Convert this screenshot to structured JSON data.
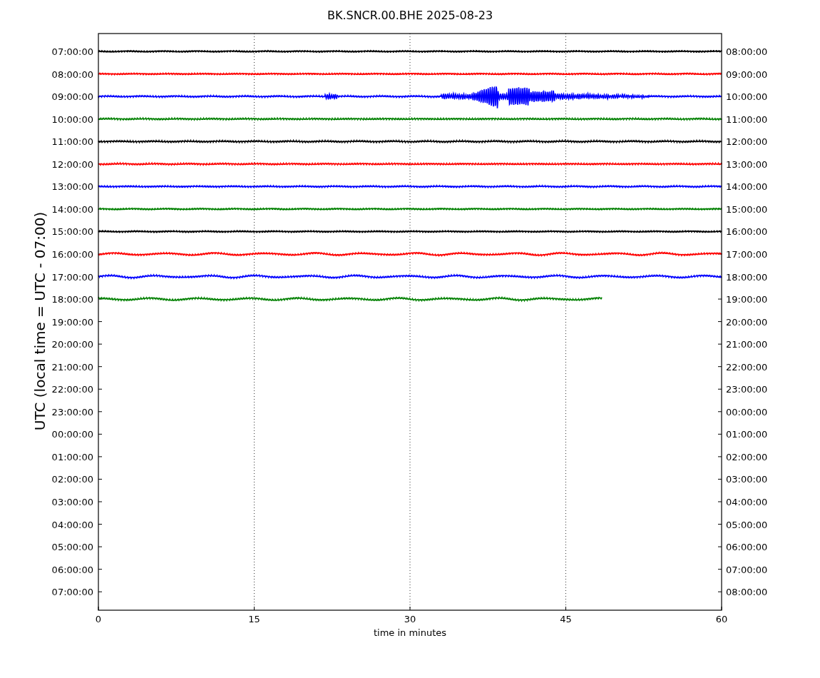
{
  "title": "BK.SNCR.00.BHE 2025-08-23",
  "ylabel": "UTC (local time = UTC - 07:00)",
  "xlabel": "time in minutes",
  "xticks": [
    "0",
    "15",
    "30",
    "45",
    "60"
  ],
  "left_labels": [
    "07:00:00",
    "08:00:00",
    "09:00:00",
    "10:00:00",
    "11:00:00",
    "12:00:00",
    "13:00:00",
    "14:00:00",
    "15:00:00",
    "16:00:00",
    "17:00:00",
    "18:00:00",
    "19:00:00",
    "20:00:00",
    "21:00:00",
    "22:00:00",
    "23:00:00",
    "00:00:00",
    "01:00:00",
    "02:00:00",
    "03:00:00",
    "04:00:00",
    "05:00:00",
    "06:00:00",
    "07:00:00"
  ],
  "right_labels": [
    "08:00:00",
    "09:00:00",
    "10:00:00",
    "11:00:00",
    "12:00:00",
    "13:00:00",
    "14:00:00",
    "15:00:00",
    "16:00:00",
    "17:00:00",
    "18:00:00",
    "19:00:00",
    "20:00:00",
    "21:00:00",
    "22:00:00",
    "23:00:00",
    "00:00:00",
    "01:00:00",
    "02:00:00",
    "03:00:00",
    "04:00:00",
    "05:00:00",
    "06:00:00",
    "07:00:00",
    "08:00:00"
  ],
  "traces": [
    {
      "kind": "quiet",
      "color": "#000000"
    },
    {
      "kind": "quiet",
      "color": "#ff0000"
    },
    {
      "kind": "event",
      "color": "#0000ff"
    },
    {
      "kind": "quiet",
      "color": "#008000"
    },
    {
      "kind": "quiet",
      "color": "#000000"
    },
    {
      "kind": "quiet",
      "color": "#ff0000"
    },
    {
      "kind": "quiet",
      "color": "#0000ff"
    },
    {
      "kind": "quiet",
      "color": "#008000"
    },
    {
      "kind": "quiet",
      "color": "#000000"
    },
    {
      "kind": "wavy",
      "color": "#ff0000"
    },
    {
      "kind": "wavy",
      "color": "#0000ff"
    },
    {
      "kind": "partial",
      "color": "#008000"
    }
  ]
}
